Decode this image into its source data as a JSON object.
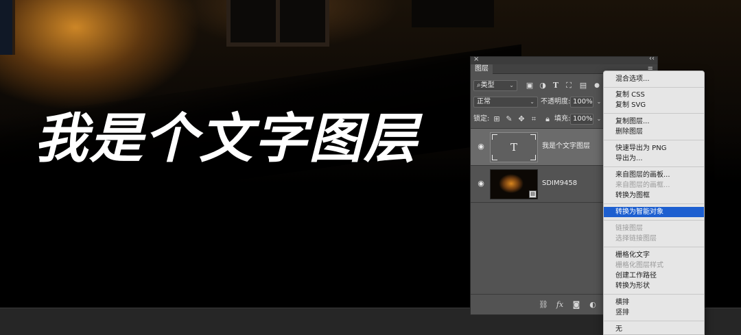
{
  "canvas_text": "我是个文字图层",
  "panel": {
    "tab_label": "图层",
    "close_glyph": "×",
    "collapse_glyph": "‹‹",
    "menu_glyph": "≡",
    "filter_kind": "类型",
    "blend_mode": "正常",
    "opacity_label": "不透明度:",
    "opacity_value": "100%",
    "lock_label": "锁定:",
    "fill_label": "填充:",
    "fill_value": "100%",
    "text_thumb_glyph": "T",
    "layers": [
      {
        "name": "我是个文字图层",
        "kind": "text",
        "selected": true
      },
      {
        "name": "SDIM9458",
        "kind": "smart-object-photo",
        "selected": false
      }
    ]
  },
  "menu": {
    "items": [
      {
        "label": "混合选项...",
        "disabled": false
      },
      {
        "label": "复制 CSS",
        "disabled": false
      },
      {
        "label": "复制 SVG",
        "disabled": false
      },
      {
        "label": "复制图层...",
        "disabled": false
      },
      {
        "label": "删除图层",
        "disabled": false
      },
      {
        "label": "快速导出为 PNG",
        "disabled": false
      },
      {
        "label": "导出为...",
        "disabled": false
      },
      {
        "label": "来自图层的画板...",
        "disabled": false
      },
      {
        "label": "来自图层的画框...",
        "disabled": true
      },
      {
        "label": "转换为图框",
        "disabled": false
      },
      {
        "label": "转换为智能对象",
        "disabled": false,
        "highlight": true
      },
      {
        "label": "链接图层",
        "disabled": true
      },
      {
        "label": "选择链接图层",
        "disabled": true
      },
      {
        "label": "栅格化文字",
        "disabled": false
      },
      {
        "label": "栅格化图层样式",
        "disabled": true
      },
      {
        "label": "创建工作路径",
        "disabled": false
      },
      {
        "label": "转换为形状",
        "disabled": false
      },
      {
        "label": "横排",
        "disabled": false
      },
      {
        "label": "竖排",
        "disabled": false
      },
      {
        "label": "无",
        "disabled": false
      }
    ]
  },
  "colors": {
    "highlight": "#1d5fd0",
    "panel_bg": "#535353",
    "menu_bg": "#e6e6e6"
  }
}
